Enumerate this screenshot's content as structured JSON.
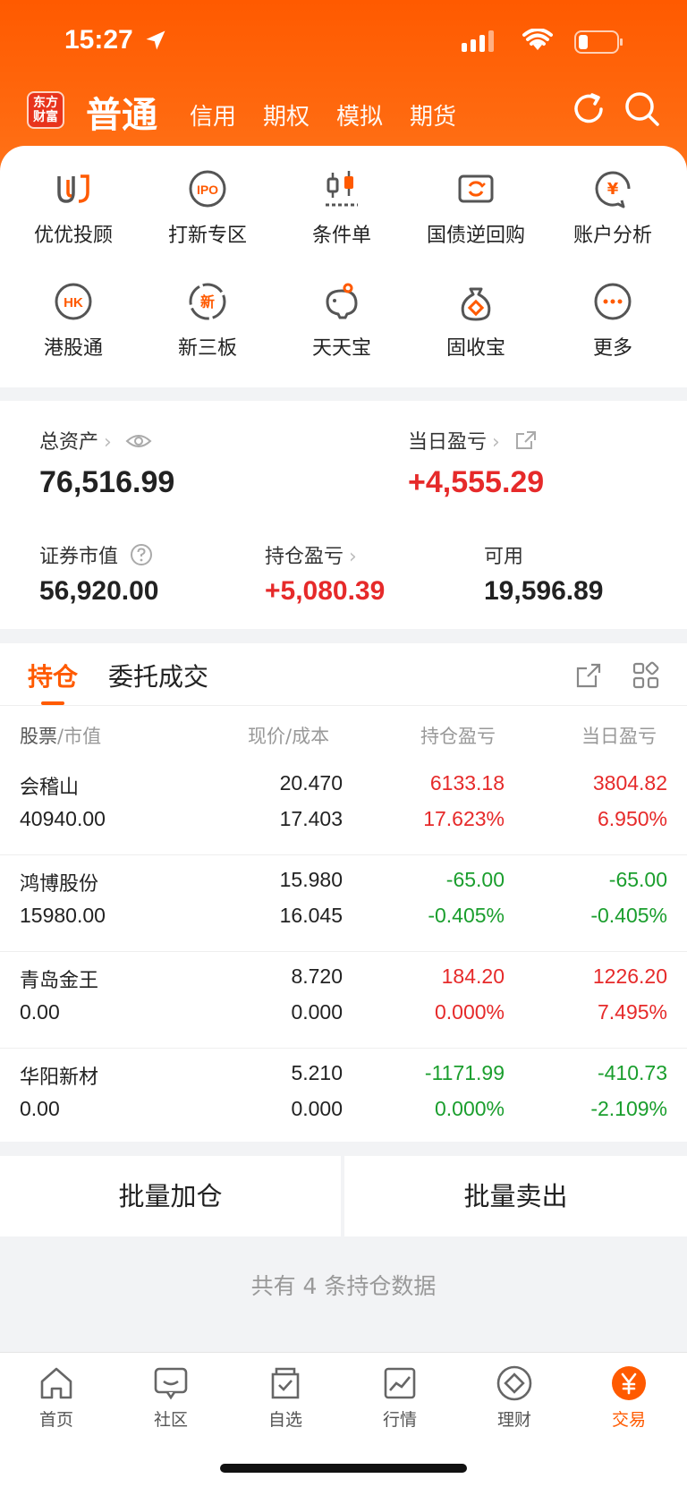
{
  "status": {
    "time": "15:27"
  },
  "header": {
    "logo_text": "东方财富",
    "main_tab": "普通",
    "tabs": [
      "信用",
      "期权",
      "模拟",
      "期货"
    ]
  },
  "quick_menu": [
    {
      "label": "优优投顾",
      "icon": "uu-advisor-icon"
    },
    {
      "label": "打新专区",
      "icon": "ipo-icon",
      "icon_text": "IPO"
    },
    {
      "label": "条件单",
      "icon": "candlestick-icon"
    },
    {
      "label": "国债逆回购",
      "icon": "bond-repo-icon"
    },
    {
      "label": "账户分析",
      "icon": "account-analysis-icon",
      "icon_text": "¥"
    },
    {
      "label": "港股通",
      "icon": "hk-icon",
      "icon_text": "HK"
    },
    {
      "label": "新三板",
      "icon": "new-third-board-icon",
      "icon_text": "新"
    },
    {
      "label": "天天宝",
      "icon": "piggy-bank-icon"
    },
    {
      "label": "固收宝",
      "icon": "money-bag-icon"
    },
    {
      "label": "更多",
      "icon": "more-icon"
    }
  ],
  "assets": {
    "total_label": "总资产",
    "total_value": "76,516.99",
    "daily_pnl_label": "当日盈亏",
    "daily_pnl_value": "+4,555.29",
    "market_value_label": "证券市值",
    "market_value": "56,920.00",
    "position_pnl_label": "持仓盈亏",
    "position_pnl_value": "+5,080.39",
    "available_label": "可用",
    "available_value": "19,596.89"
  },
  "positions": {
    "tabs": [
      "持仓",
      "委托成交"
    ],
    "headers": {
      "stock": "股票",
      "market_value": "市值",
      "price": "现价",
      "cost": "成本",
      "position_pnl": "持仓盈亏",
      "daily_pnl": "当日盈亏"
    },
    "rows": [
      {
        "name": "会稽山",
        "market_value": "40940.00",
        "price": "20.470",
        "cost": "17.403",
        "pnl": "6133.18",
        "pnl_pct": "17.623%",
        "daily": "3804.82",
        "daily_pct": "6.950%",
        "pnl_color": "red",
        "daily_color": "red"
      },
      {
        "name": "鸿博股份",
        "market_value": "15980.00",
        "price": "15.980",
        "cost": "16.045",
        "pnl": "-65.00",
        "pnl_pct": "-0.405%",
        "daily": "-65.00",
        "daily_pct": "-0.405%",
        "pnl_color": "green",
        "daily_color": "green"
      },
      {
        "name": "青岛金王",
        "market_value": "0.00",
        "price": "8.720",
        "cost": "0.000",
        "pnl": "184.20",
        "pnl_pct": "0.000%",
        "daily": "1226.20",
        "daily_pct": "7.495%",
        "pnl_color": "red",
        "daily_color": "red"
      },
      {
        "name": "华阳新材",
        "market_value": "0.00",
        "price": "5.210",
        "cost": "0.000",
        "pnl": "-1171.99",
        "pnl_pct": "0.000%",
        "daily": "-410.73",
        "daily_pct": "-2.109%",
        "pnl_color": "green",
        "daily_color": "green"
      }
    ]
  },
  "batch": {
    "add": "批量加仓",
    "sell": "批量卖出"
  },
  "footer_note": "共有 4 条持仓数据",
  "tabbar": [
    {
      "label": "首页",
      "icon": "home-icon"
    },
    {
      "label": "社区",
      "icon": "community-icon"
    },
    {
      "label": "自选",
      "icon": "watchlist-icon"
    },
    {
      "label": "行情",
      "icon": "market-icon"
    },
    {
      "label": "理财",
      "icon": "wealth-icon"
    },
    {
      "label": "交易",
      "icon": "trade-icon",
      "active": true
    }
  ],
  "colors": {
    "brand": "#ff5a00",
    "up": "#e62a2a",
    "down": "#1a9e2d"
  }
}
